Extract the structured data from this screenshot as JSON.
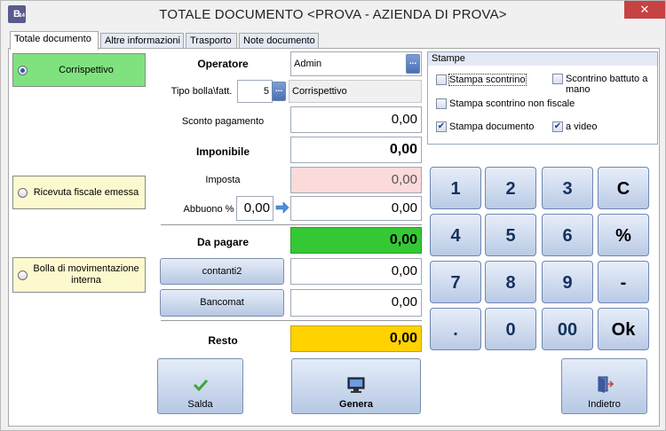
{
  "window": {
    "title": "TOTALE DOCUMENTO <PROVA - AZIENDA DI PROVA>",
    "icon_letter": "B",
    "icon_sub": "14",
    "close": "✕"
  },
  "tabs": [
    "Totale documento",
    "Altre informazioni",
    "Trasporto",
    "Note documento"
  ],
  "doc_types": [
    "Corrispettivo",
    "Ricevuta fiscale emessa",
    "Bolla di movimentazione interna"
  ],
  "form": {
    "operatore_label": "Operatore",
    "operatore_value": "Admin",
    "tipo_label": "Tipo bolla\\fatt.",
    "tipo_code": "5",
    "tipo_desc": "Corrispettivo",
    "sconto_label": "Sconto pagamento",
    "sconto_value": "0,00",
    "imponibile_label": "Imponibile",
    "imponibile_value": "0,00",
    "imposta_label": "Imposta",
    "imposta_value": "0,00",
    "abbuono_label": "Abbuono %",
    "abbuono_pct": "0,00",
    "abbuono_value": "0,00",
    "dapagare_label": "Da pagare",
    "dapagare_value": "0,00",
    "pay1_label": "contanti2",
    "pay1_value": "0,00",
    "pay2_label": "Bancomat",
    "pay2_value": "0,00",
    "resto_label": "Resto",
    "resto_value": "0,00",
    "ellipsis": "..."
  },
  "stampe": {
    "title": "Stampe",
    "scontrino": "Stampa scontrino",
    "scontrino_mano": "Scontrino battuto a mano",
    "non_fiscale": "Stampa scontrino non fiscale",
    "documento": "Stampa documento",
    "a_video": "a video",
    "checked": [
      "documento",
      "a_video"
    ]
  },
  "keypad": [
    "1",
    "2",
    "3",
    "C",
    "4",
    "5",
    "6",
    "%",
    "7",
    "8",
    "9",
    "-",
    ".",
    "0",
    "00",
    "Ok"
  ],
  "actions": {
    "salda": "Salda",
    "genera": "Genera",
    "indietro": "Indietro"
  },
  "colors": {
    "selected_type": "#7fe27f",
    "unselected_type": "#fdf9cf",
    "imposta": "#fbdada",
    "dapagare": "#35c835",
    "resto": "#ffd200",
    "keypad_text": "#14325e"
  },
  "icons": {
    "salda": "checkmark-icon",
    "genera": "monitor-icon",
    "indietro": "exit-door-icon",
    "abbuono_arrow": "arrow-right-icon"
  }
}
